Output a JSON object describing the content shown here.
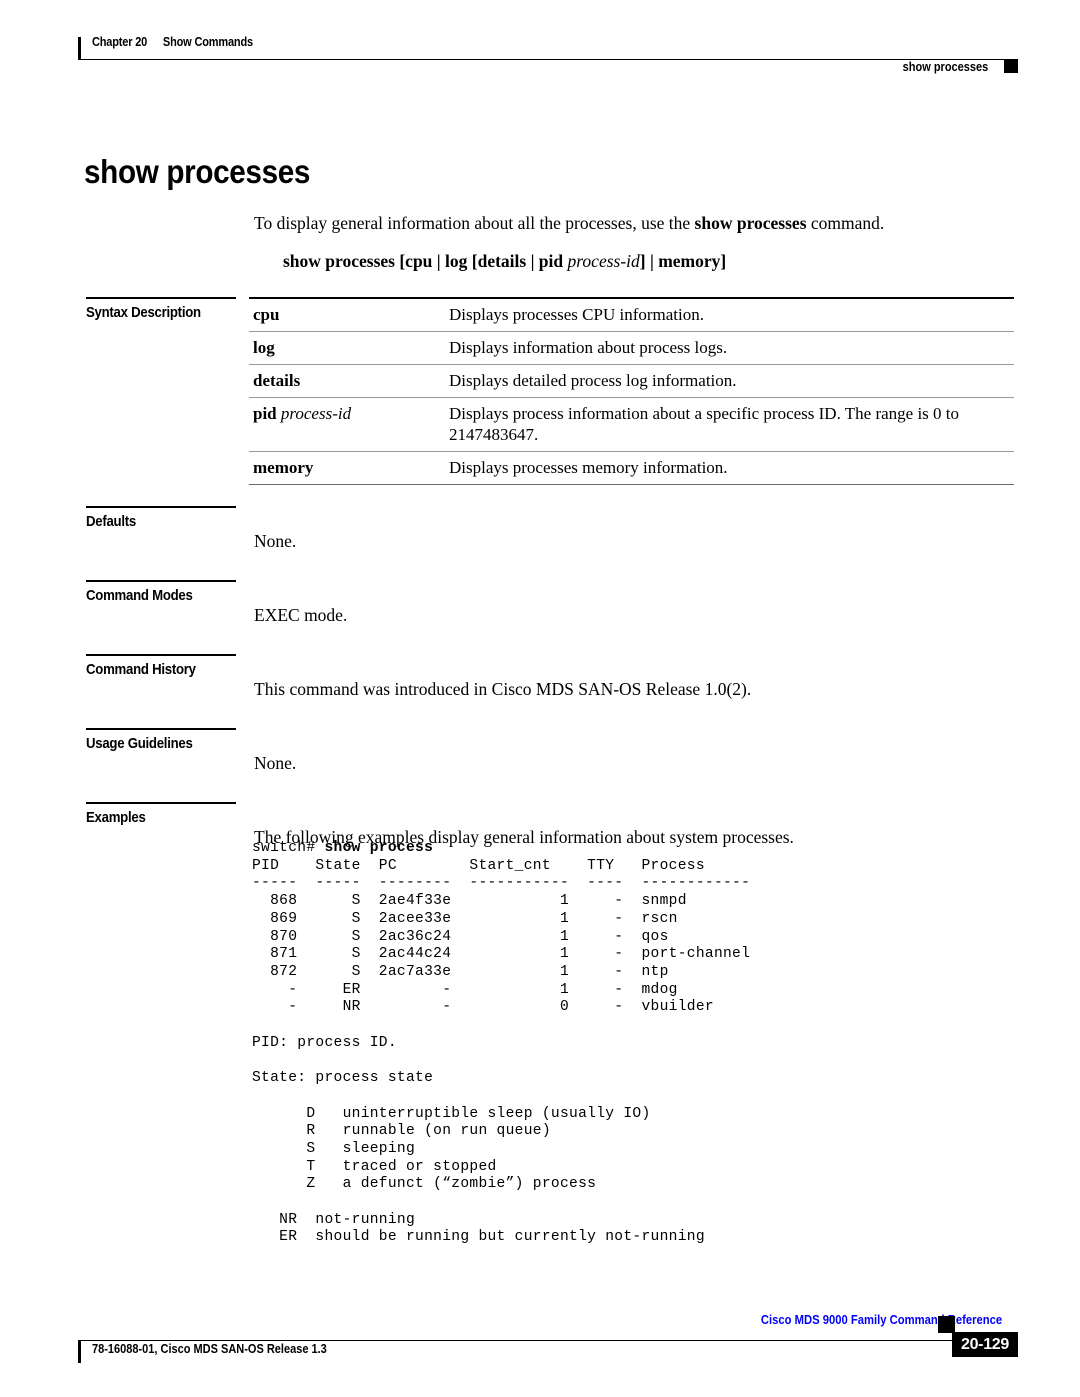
{
  "header": {
    "chapter": "Chapter 20",
    "section": "Show Commands",
    "running_head": "show processes"
  },
  "title": "show processes",
  "intro_before": "To display general information about all the processes, use the ",
  "intro_bold": "show processes",
  "intro_after": " command.",
  "syntax": {
    "command": "show processes",
    "options_before": " [cpu | log [details | pid ",
    "italic_arg": "process-id",
    "options_after": "] | memory]"
  },
  "sections": {
    "syntax_description": "Syntax Description",
    "defaults": "Defaults",
    "command_modes": "Command Modes",
    "command_history": "Command History",
    "usage_guidelines": "Usage Guidelines",
    "examples": "Examples"
  },
  "syntax_table": [
    {
      "term": "cpu",
      "term_italic": "",
      "desc": "Displays processes CPU information."
    },
    {
      "term": "log",
      "term_italic": "",
      "desc": "Displays information about process logs."
    },
    {
      "term": "details",
      "term_italic": "",
      "desc": "Displays detailed process log information."
    },
    {
      "term": "pid",
      "term_italic": "process-id",
      "desc": "Displays process information about a specific process ID. The range is 0 to 2147483647."
    },
    {
      "term": "memory",
      "term_italic": "",
      "desc": "Displays processes memory information."
    }
  ],
  "defaults_text": "None.",
  "command_modes_text": "EXEC mode.",
  "command_history_text": "This command was introduced in Cisco MDS SAN-OS Release 1.0(2).",
  "usage_guidelines_text": "None.",
  "examples_text": "The following examples display general information about system processes.",
  "code": {
    "prompt": "switch# ",
    "command": "show process",
    "output": "PID    State  PC        Start_cnt    TTY   Process\n-----  -----  --------  -----------  ----  ------------\n  868      S  2ae4f33e            1     -  snmpd\n  869      S  2acee33e            1     -  rscn\n  870      S  2ac36c24            1     -  qos\n  871      S  2ac44c24            1     -  port-channel\n  872      S  2ac7a33e            1     -  ntp\n    -     ER         -            1     -  mdog\n    -     NR         -            0     -  vbuilder\n\nPID: process ID.\n\nState: process state\n\n      D   uninterruptible sleep (usually IO)\n      R   runnable (on run queue)\n      S   sleeping\n      T   traced or stopped\n      Z   a defunct (“zombie”) process\n\n   NR  not-running\n   ER  should be running but currently not-running"
  },
  "footer": {
    "left": "78-16088-01, Cisco MDS SAN-OS Release 1.3",
    "right": "Cisco MDS 9000 Family Command Reference",
    "page": "20-129"
  }
}
